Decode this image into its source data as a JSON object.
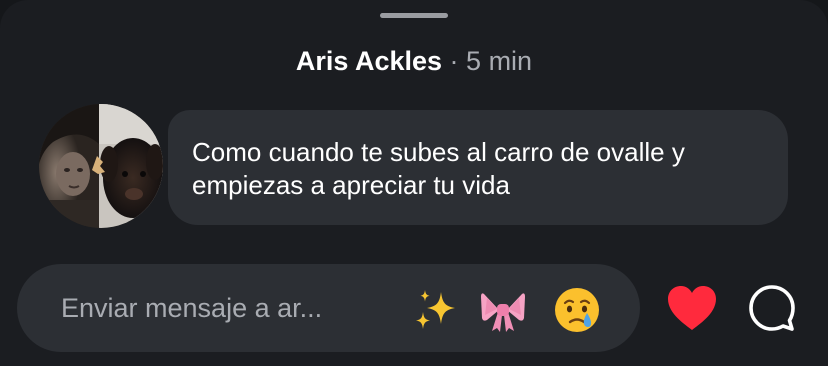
{
  "comment": {
    "author": "Aris Ackles",
    "separator": "·",
    "time": "5 min",
    "text": "Como cuando te subes al carro de ovalle y empiezas a apreciar tu vida"
  },
  "composer": {
    "placeholder": "Enviar mensaje a ar...",
    "quick_reactions": [
      "sparkles-emoji",
      "pink-ribbon-emoji",
      "crying-face-emoji"
    ]
  },
  "actions": {
    "like_icon": "heart-icon",
    "comment_icon": "comment-bubble-icon"
  },
  "colors": {
    "background": "#1b1d21",
    "bubble": "#2c2f34",
    "heart": "#ff2a3d",
    "text": "#ffffff",
    "secondary_text": "#a9acb2"
  }
}
